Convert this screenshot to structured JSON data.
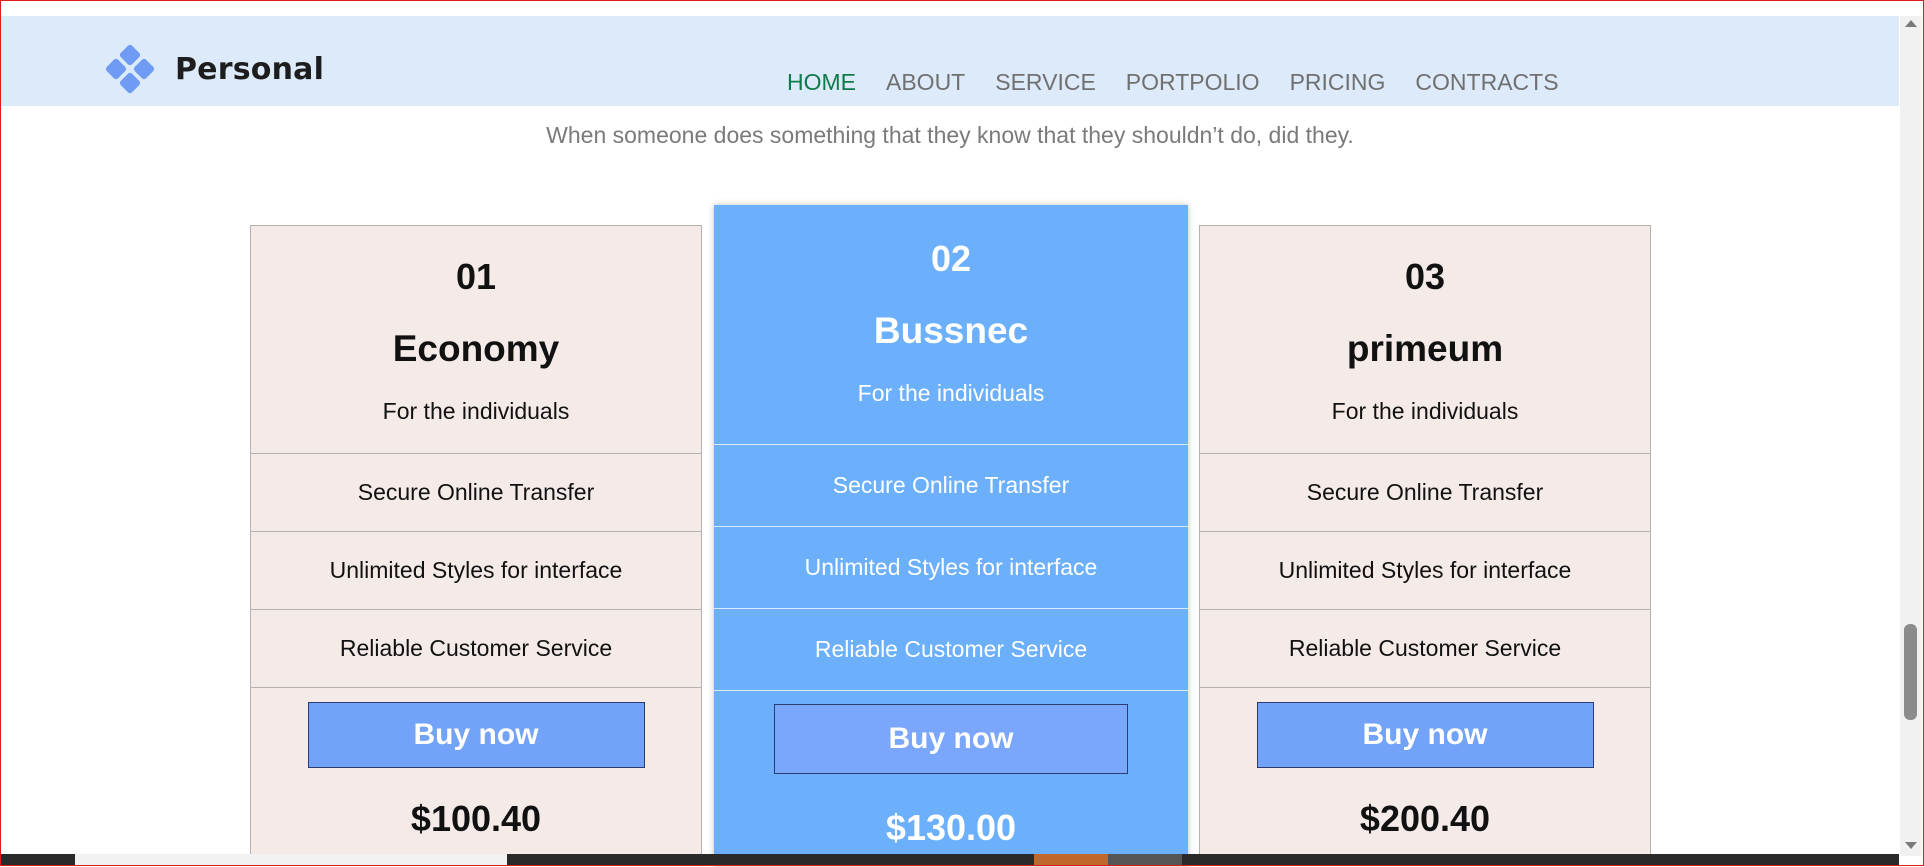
{
  "header": {
    "logo_text": "Personal",
    "nav": [
      "HOME",
      "ABOUT",
      "SERVICE",
      "PORTPOLIO",
      "PRICING",
      "CONTRACTS"
    ],
    "active_nav": "HOME"
  },
  "section": {
    "subtitle": "When someone does something that they know that they shouldn’t do, did they."
  },
  "plans": [
    {
      "number": "01",
      "name": "Economy",
      "desc": "For the individuals",
      "features": [
        "Secure Online Transfer",
        "Unlimited Styles for interface",
        "Reliable Customer Service"
      ],
      "button": "Buy now",
      "price": "$100.40"
    },
    {
      "number": "02",
      "name": "Bussnec",
      "desc": "For the individuals",
      "features": [
        "Secure Online Transfer",
        "Unlimited Styles for interface",
        "Reliable Customer Service"
      ],
      "button": "Buy now",
      "price": "$130.00"
    },
    {
      "number": "03",
      "name": "primeum",
      "desc": "For the individuals",
      "features": [
        "Secure Online Transfer",
        "Unlimited Styles for interface",
        "Reliable Customer Service"
      ],
      "button": "Buy now",
      "price": "$200.40"
    }
  ],
  "colors": {
    "navbar_bg": "#dceafa",
    "active_nav": "#107a4a",
    "featured_card": "#6cb0fc",
    "card_bg": "#f4ebe8",
    "button": "#72a3f8"
  }
}
